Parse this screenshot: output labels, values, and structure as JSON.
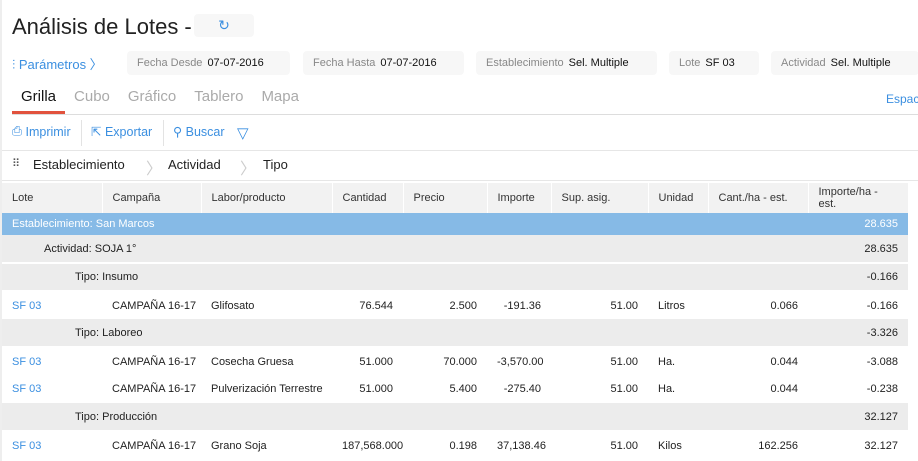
{
  "header": {
    "title": "Análisis de Lotes - .",
    "parametros": "Parámetros 〉"
  },
  "filters": [
    {
      "label": "Fecha Desde",
      "value": "07-07-2016"
    },
    {
      "label": "Fecha Hasta",
      "value": "07-07-2016"
    },
    {
      "label": "Establecimiento",
      "value": "Sel. Multiple"
    },
    {
      "label": "Lote",
      "value": "SF 03"
    },
    {
      "label": "Actividad",
      "value": "Sel. Multiple"
    }
  ],
  "tabs": [
    "Grilla",
    "Cubo",
    "Gráfico",
    "Tablero",
    "Mapa"
  ],
  "espacio": "Espacio",
  "toolbar": {
    "print": "Imprimir",
    "export": "Exportar",
    "search": "Buscar"
  },
  "groupby": [
    "Establecimiento",
    "Actividad",
    "Tipo"
  ],
  "columns": [
    "Lote",
    "Campaña",
    "Labor/producto",
    "Cantidad",
    "Precio",
    "Importe",
    "Sup. asig.",
    "Unidad",
    "Cant./ha - est.",
    "Importe/ha - est."
  ],
  "groups": {
    "est": {
      "label": "Establecimiento: San Marcos",
      "total": "28.635"
    },
    "act": {
      "label": "Actividad: SOJA 1°",
      "total": "28.635"
    },
    "t1": {
      "label": "Tipo: Insumo",
      "total": "-0.166"
    },
    "t2": {
      "label": "Tipo: Laboreo",
      "total": "-3.326"
    },
    "t3": {
      "label": "Tipo: Producción",
      "total": "32.127"
    }
  },
  "rows": [
    [
      "SF 03",
      "CAMPAÑA 16-17",
      "Glifosato",
      "76.544",
      "2.500",
      "-191.36",
      "51.00",
      "Litros",
      "0.066",
      "-0.166"
    ],
    [
      "SF 03",
      "CAMPAÑA 16-17",
      "Cosecha Gruesa",
      "51.000",
      "70.000",
      "-3,570.00",
      "51.00",
      "Ha.",
      "0.044",
      "-3.088"
    ],
    [
      "SF 03",
      "CAMPAÑA 16-17",
      "Pulverización Terrestre",
      "51.000",
      "5.400",
      "-275.40",
      "51.00",
      "Ha.",
      "0.044",
      "-0.238"
    ],
    [
      "SF 03",
      "CAMPAÑA 16-17",
      "Grano Soja",
      "187,568.000",
      "0.198",
      "37,138.46",
      "51.00",
      "Kilos",
      "162.256",
      "32.127"
    ]
  ]
}
